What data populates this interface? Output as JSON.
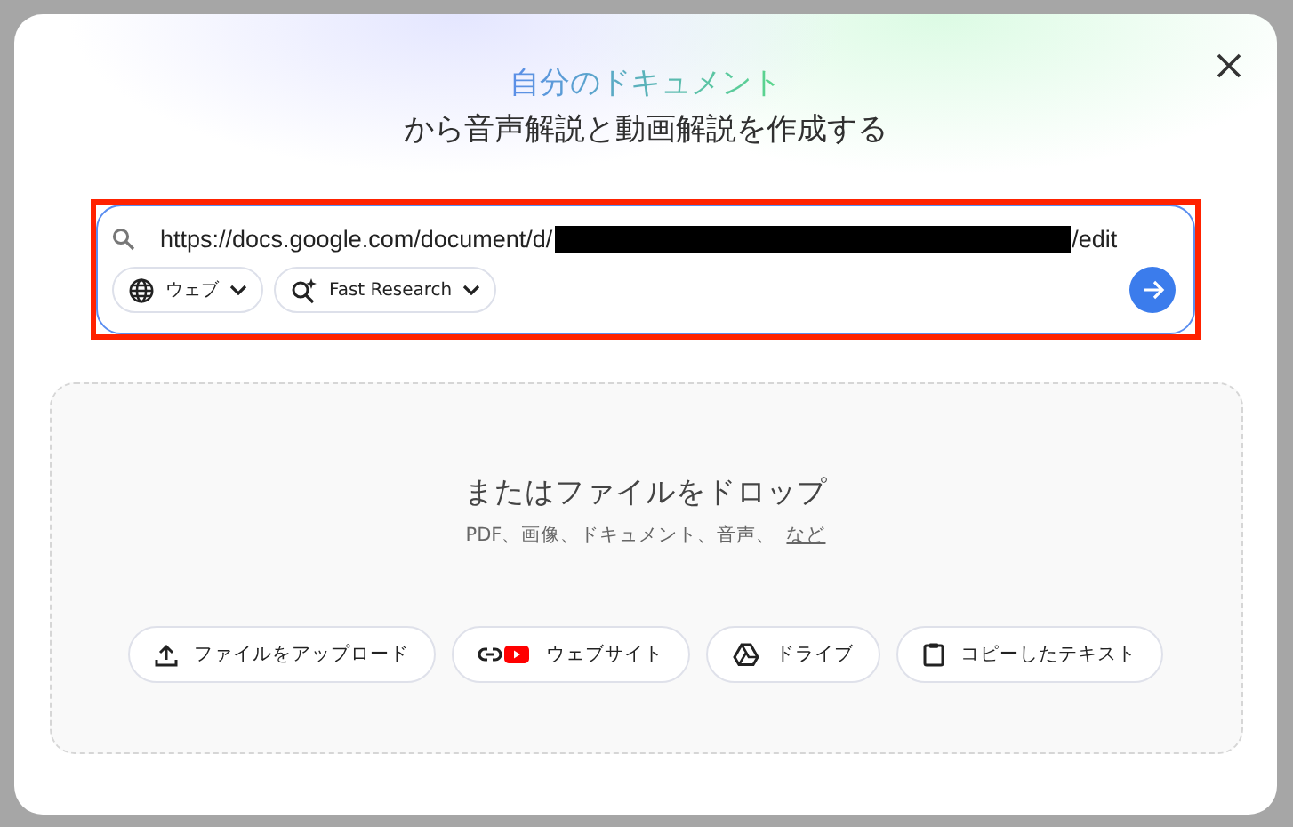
{
  "dialog": {
    "title_highlight": "自分のドキュメント",
    "title_rest": "から音声解説と動画解説を作成する"
  },
  "search": {
    "url_prefix": "https://docs.google.com/document/d/",
    "url_redacted": true,
    "url_suffix": "/edit",
    "highlighted": true,
    "chips": [
      {
        "kind": "globe",
        "label": "ウェブ"
      },
      {
        "kind": "research",
        "label": "Fast Research"
      }
    ]
  },
  "drop_zone": {
    "title": "またはファイルをドロップ",
    "subtitle": "PDF、画像、ドキュメント、音声、",
    "more_link": "など",
    "buttons": [
      {
        "kind": "upload",
        "label": "ファイルをアップロード"
      },
      {
        "kind": "website",
        "label": "ウェブサイト"
      },
      {
        "kind": "drive",
        "label": "ドライブ"
      },
      {
        "kind": "clipboard",
        "label": "コピーしたテキスト"
      }
    ]
  }
}
